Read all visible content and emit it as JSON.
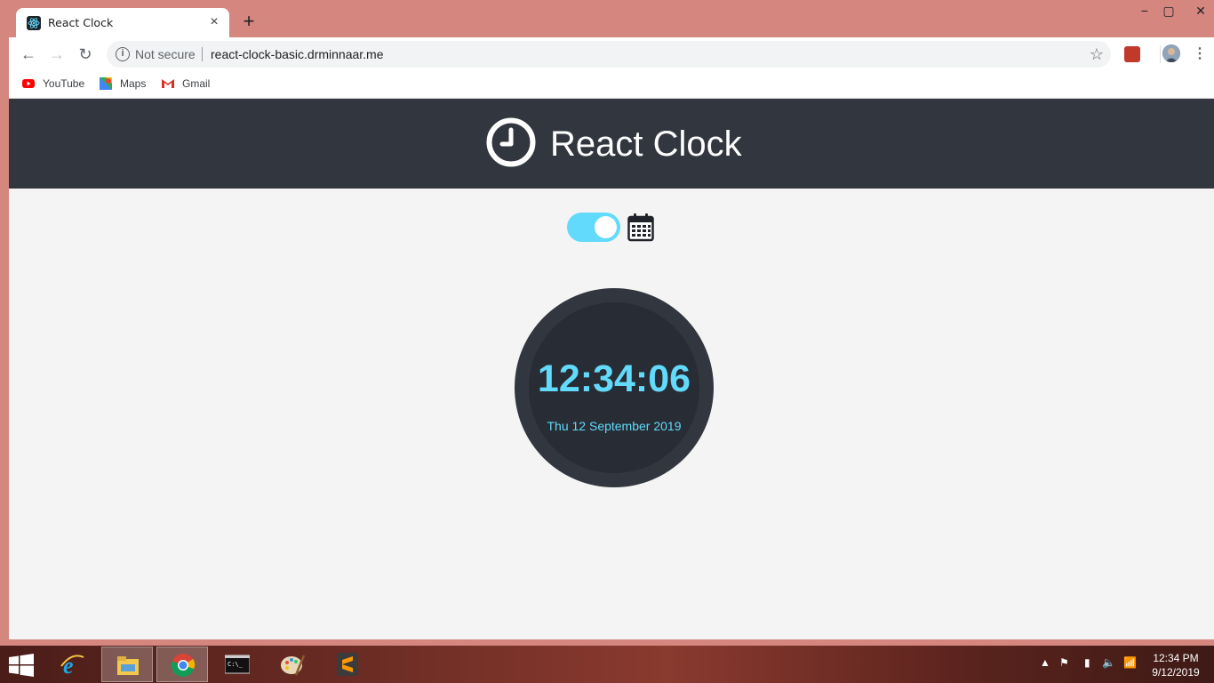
{
  "browser": {
    "tab": {
      "title": "React Clock",
      "close_glyph": "×"
    },
    "new_tab_glyph": "+",
    "window_controls": {
      "minimize": "−",
      "maximize": "▢",
      "close": "✕"
    },
    "nav": {
      "back": "←",
      "forward": "→",
      "reload": "↻"
    },
    "omnibox": {
      "security_label": "Not secure",
      "url": "react-clock-basic.drminnaar.me",
      "info_glyph": "i",
      "star_glyph": "☆"
    },
    "menu_glyph": "⋮",
    "bookmarks": [
      {
        "label": "YouTube",
        "icon": "youtube-icon"
      },
      {
        "label": "Maps",
        "icon": "maps-icon"
      },
      {
        "label": "Gmail",
        "icon": "gmail-icon"
      }
    ]
  },
  "app": {
    "title": "React Clock",
    "toggle_state": "on",
    "time": "12:34:06",
    "date": "Thu 12 September 2019",
    "colors": {
      "header_bg": "#31363f",
      "accent": "#61dafb",
      "face": "#282c34",
      "page_bg": "#f4f4f4"
    }
  },
  "taskbar": {
    "apps": [
      "internet-explorer-icon",
      "file-explorer-icon",
      "chrome-icon",
      "command-prompt-icon",
      "paint-icon",
      "sublime-text-icon"
    ],
    "time": "12:34 PM",
    "date": "9/12/2019"
  }
}
